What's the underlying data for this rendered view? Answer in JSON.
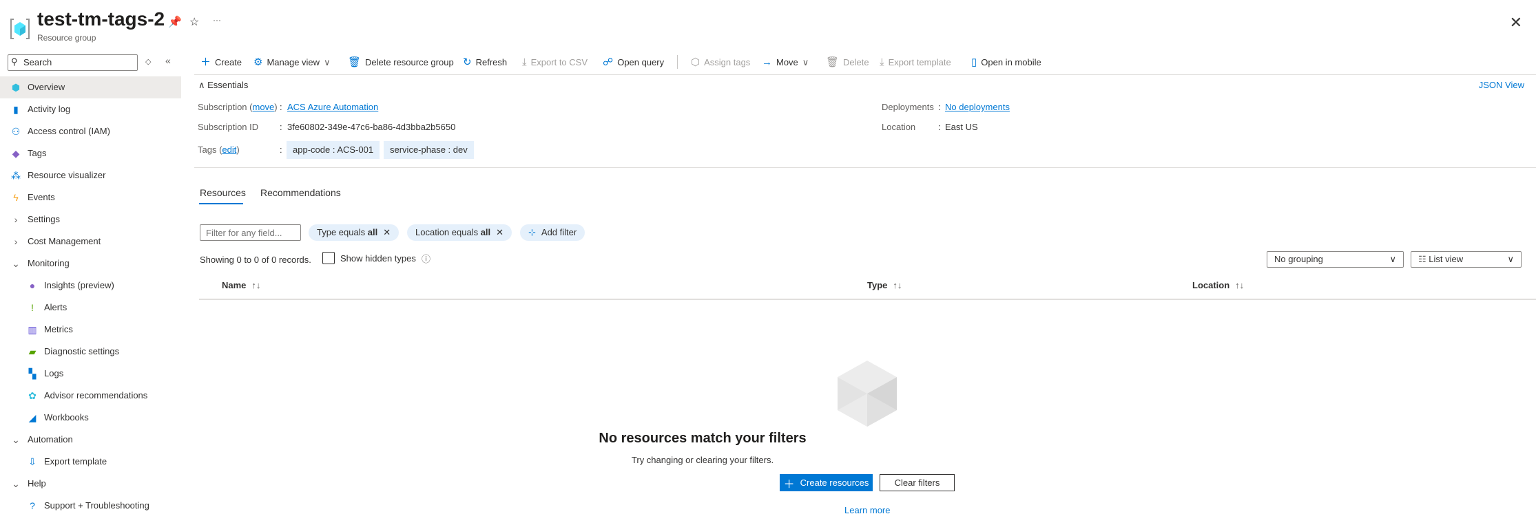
{
  "header": {
    "title": "test-tm-tags-2",
    "subtitle": "Resource group",
    "pin": "☆",
    "more": "···"
  },
  "sidebar": {
    "search_placeholder": "Search",
    "items": [
      {
        "label": "Overview",
        "icon": "resource-group-icon"
      },
      {
        "label": "Activity log",
        "icon": "activity-log-icon"
      },
      {
        "label": "Access control (IAM)",
        "icon": "iam-icon"
      },
      {
        "label": "Tags",
        "icon": "tag-icon"
      },
      {
        "label": "Resource visualizer",
        "icon": "visualizer-icon"
      },
      {
        "label": "Events",
        "icon": "lightning-icon"
      },
      {
        "label": "Settings",
        "icon": "chevron-right-icon"
      },
      {
        "label": "Cost Management",
        "icon": "chevron-right-icon"
      },
      {
        "label": "Monitoring",
        "icon": "chevron-down-icon"
      },
      {
        "label": "Insights (preview)",
        "icon": "lightbulb-icon"
      },
      {
        "label": "Alerts",
        "icon": "alert-icon"
      },
      {
        "label": "Metrics",
        "icon": "metrics-icon"
      },
      {
        "label": "Diagnostic settings",
        "icon": "diagnostic-icon"
      },
      {
        "label": "Logs",
        "icon": "logs-icon"
      },
      {
        "label": "Advisor recommendations",
        "icon": "advisor-icon"
      },
      {
        "label": "Workbooks",
        "icon": "workbooks-icon"
      },
      {
        "label": "Automation",
        "icon": "chevron-down-icon"
      },
      {
        "label": "Export template",
        "icon": "export-template-icon"
      },
      {
        "label": "Help",
        "icon": "chevron-down-icon"
      },
      {
        "label": "Support + Troubleshooting",
        "icon": "help-icon"
      }
    ]
  },
  "toolbar": {
    "create": "Create",
    "manage_view": "Manage view",
    "delete_rg": "Delete resource group",
    "refresh": "Refresh",
    "export_csv": "Export to CSV",
    "open_query": "Open query",
    "assign_tags": "Assign tags",
    "move": "Move",
    "delete": "Delete",
    "export_template": "Export template",
    "open_mobile": "Open in mobile"
  },
  "essentials": {
    "title": "Essentials",
    "json_view": "JSON View",
    "subscription_label": "Subscription",
    "move_link": "move",
    "subscription_value": "ACS Azure Automation",
    "subscription_id_label": "Subscription ID",
    "subscription_id": "3fe60802-349e-47c6-ba86-4d3bba2b5650",
    "tags_label": "Tags",
    "edit_link": "edit",
    "tags": [
      "app-code : ACS-001",
      "service-phase : dev"
    ],
    "deployments_label": "Deployments",
    "deployments_value": "No deployments",
    "location_label": "Location",
    "location_value": "East US"
  },
  "tabs": [
    "Resources",
    "Recommendations"
  ],
  "filters": {
    "placeholder": "Filter for any field...",
    "type_chip": "Type equals",
    "type_value": "all",
    "location_chip": "Location equals",
    "location_value": "all",
    "add_filter": "Add filter"
  },
  "records": "Showing 0 to 0 of 0 records.",
  "show_hidden": "Show hidden types",
  "grouping": "No grouping",
  "view": "List view",
  "columns": [
    "Name",
    "Type",
    "Location"
  ],
  "empty": {
    "title": "No resources match your filters",
    "subtitle": "Try changing or clearing your filters.",
    "create": "Create resources",
    "clear": "Clear filters",
    "learn_more": "Learn more"
  },
  "colors": {
    "accent": "#0078d4"
  }
}
